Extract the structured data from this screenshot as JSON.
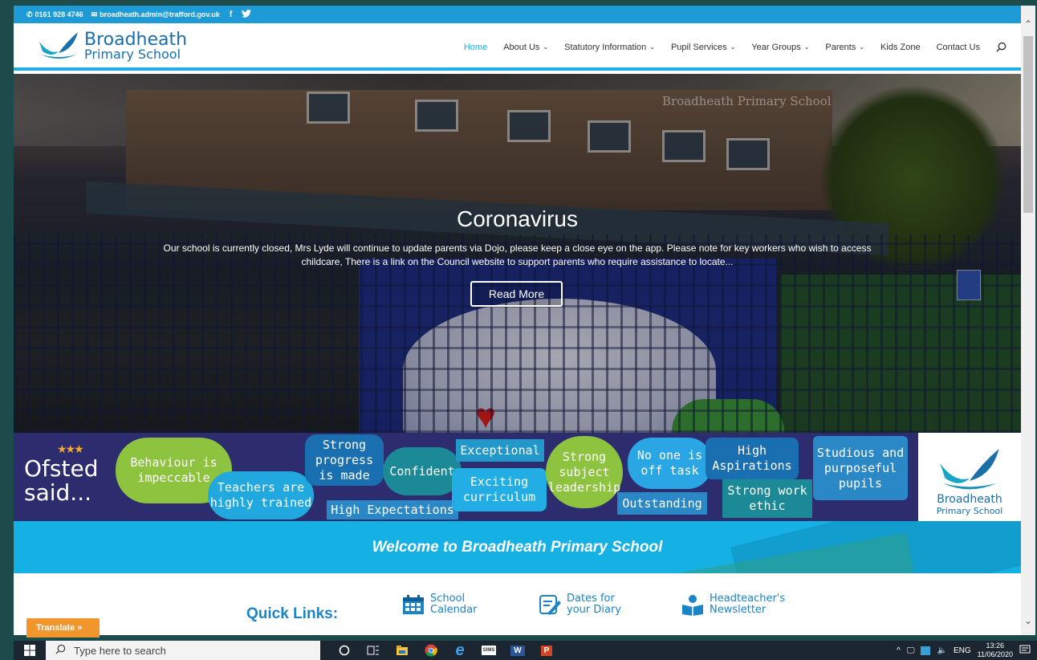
{
  "topbar": {
    "phone": "0161 928 4746",
    "email": "broadheath.admin@trafford.gov.uk",
    "facebook_icon": "f",
    "twitter_icon": "🐦"
  },
  "logo": {
    "line1": "Broadheath",
    "line2": "Primary School"
  },
  "nav": {
    "items": [
      {
        "label": "Home"
      },
      {
        "label": "About Us"
      },
      {
        "label": "Statutory Information"
      },
      {
        "label": "Pupil Services"
      },
      {
        "label": "Year Groups"
      },
      {
        "label": "Parents"
      },
      {
        "label": "Kids Zone"
      },
      {
        "label": "Contact Us"
      }
    ],
    "accent": "#1eaee5"
  },
  "hero": {
    "watermark": "Broadheath Primary School",
    "title": "Coronavirus",
    "text": "Our school is currently closed, Mrs Lyde will continue to update parents via Dojo, please keep a close eye on the app.  Please note for key workers who wish to access childcare, There is a link on the Council website to support parents who require assistance to locate...",
    "button": "Read More"
  },
  "ofsted": {
    "line1": "Ofsted",
    "line2": "said...",
    "bubbles": [
      "Behaviour is impeccable",
      "Teachers are highly trained",
      "Strong progress is made",
      "High Expectations",
      "Confident",
      "Exceptional",
      "Exciting curriculum",
      "Strong subject leadership",
      "No one is off task",
      "Outstanding",
      "High Aspirations",
      "Strong work ethic",
      "Studious and purposeful pupils"
    ],
    "logo_line1": "Broadheath",
    "logo_line2": "Primary School"
  },
  "welcome": "Welcome to Broadheath Primary School",
  "quick_links": {
    "label": "Quick Links:",
    "items": [
      {
        "line1": "School",
        "line2": "Calendar",
        "icon": "calendar-icon"
      },
      {
        "line1": "Dates for",
        "line2": "your Diary",
        "icon": "diary-icon"
      },
      {
        "line1": "Headteacher's",
        "line2": "Newsletter",
        "icon": "reader-icon"
      }
    ]
  },
  "translate": "Translate »",
  "taskbar": {
    "search_placeholder": "Type here to search",
    "apps": [
      "cortana",
      "task-view",
      "file-explorer",
      "chrome",
      "edge",
      "sims",
      "word",
      "powerpoint"
    ],
    "sims_label": "SIMS",
    "word_label": "W",
    "ppt_label": "P",
    "lang": "ENG",
    "time": "13:26",
    "date": "11/06/2020"
  }
}
